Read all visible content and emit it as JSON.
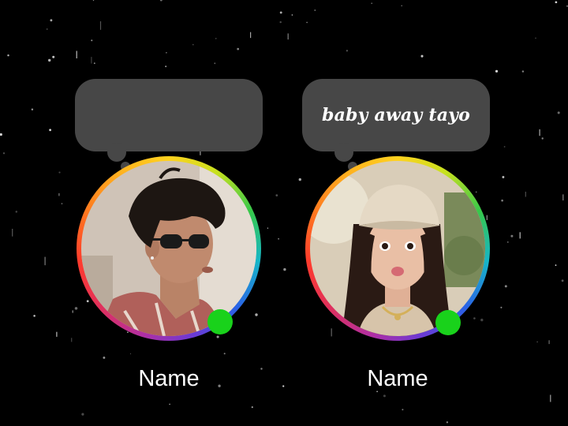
{
  "profiles": [
    {
      "note": "",
      "name": "Name",
      "status": "online",
      "photo_icon": "profile-photo-man-sunglasses"
    },
    {
      "note": "baby away tayo",
      "name": "Name",
      "status": "online",
      "photo_icon": "profile-photo-woman-cap"
    }
  ],
  "colors": {
    "background": "#000000",
    "bubble": "#474747",
    "online": "#19d21b",
    "text": "#ffffff"
  }
}
